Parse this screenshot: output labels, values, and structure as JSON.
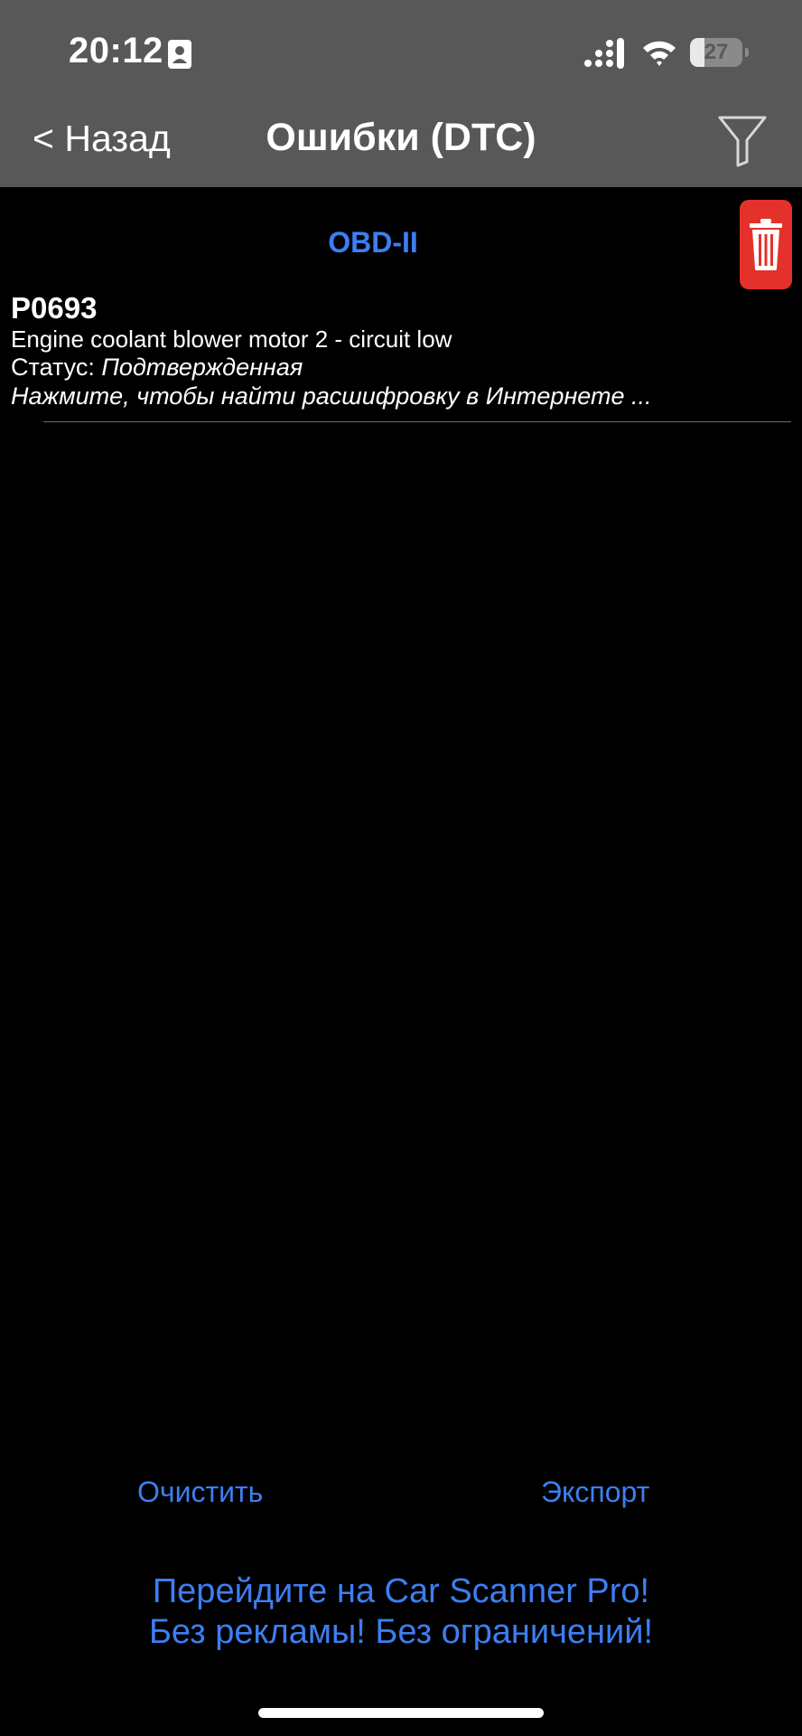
{
  "status_bar": {
    "time": "20:12",
    "battery_percent": "27",
    "battery_level": 0.27,
    "icons": [
      "person-card-icon",
      "cellular-signal-icon",
      "wifi-icon",
      "battery-icon"
    ]
  },
  "nav": {
    "back_label": "< Назад",
    "title": "Ошибки (DTC)",
    "filter_icon": "filter-funnel-icon"
  },
  "section": {
    "title": "OBD-II",
    "delete_icon": "trash-icon"
  },
  "dtc_list": [
    {
      "code": "P0693",
      "description": "Engine coolant blower motor 2 - circuit low",
      "status_label": "Статус: ",
      "status_value": "Подтвержденная",
      "hint": "Нажмите, чтобы найти расшифровку в Интернете ..."
    }
  ],
  "footer": {
    "clear_label": "Очистить",
    "export_label": "Экспорт",
    "promo_line1": "Перейдите на Car Scanner Pro!",
    "promo_line2": "Без рекламы! Без ограничений!"
  },
  "colors": {
    "accent": "#3d7ef2",
    "header_bg": "#585858",
    "background": "#000000",
    "delete_bg": "#e5312b"
  }
}
